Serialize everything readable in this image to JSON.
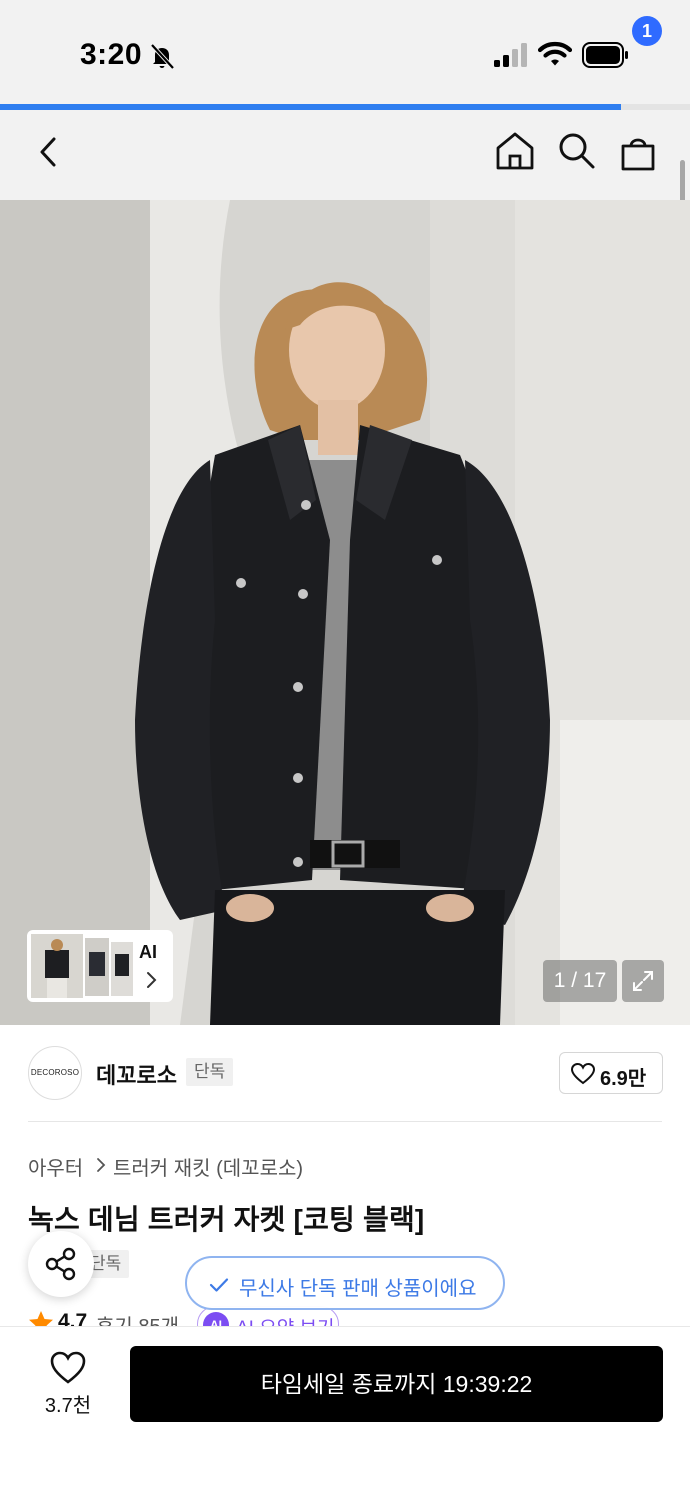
{
  "status_bar": {
    "time": "3:20",
    "icons": [
      "bell-slash-icon",
      "cellular-signal-icon",
      "wifi-icon",
      "battery-icon"
    ]
  },
  "page_progress": 0.9,
  "nav": {
    "icons": [
      "back-arrow-icon",
      "home-icon",
      "search-icon",
      "shopping-bag-icon"
    ],
    "cart_count": "1"
  },
  "gallery": {
    "thumbnail_label": "AI",
    "counter": "1 / 17",
    "colors": {
      "backdrop": "#d9d8d4",
      "jacket": "#1c1d20"
    }
  },
  "brand": {
    "logo_text": "DECOROSO",
    "name": "데꼬로소",
    "tag": "단독",
    "likes": "6.9만"
  },
  "breadcrumb": [
    "아우터",
    "트러커 재킷 (데꼬로소)"
  ],
  "product": {
    "title": "녹스 데님 트러커 자켓 [코팅 블랙]",
    "exclusive_tag": "단독",
    "rating": "4.7",
    "reviews": "후기 85개",
    "ai_summary_badge": "AI",
    "ai_summary_label": "AI 요약 보기"
  },
  "toast": {
    "text": "무신사 단독 판매 상품이에요",
    "color": "#3d7ae6"
  },
  "bottom_bar": {
    "like_count": "3.7천",
    "buy_button_label": "타임세일 종료까지 19:39:22"
  },
  "colors": {
    "accent": "#2f6bff",
    "progress": "#2f7ef0",
    "ai_purple": "#7c4df2",
    "star": "#ff8a00"
  }
}
